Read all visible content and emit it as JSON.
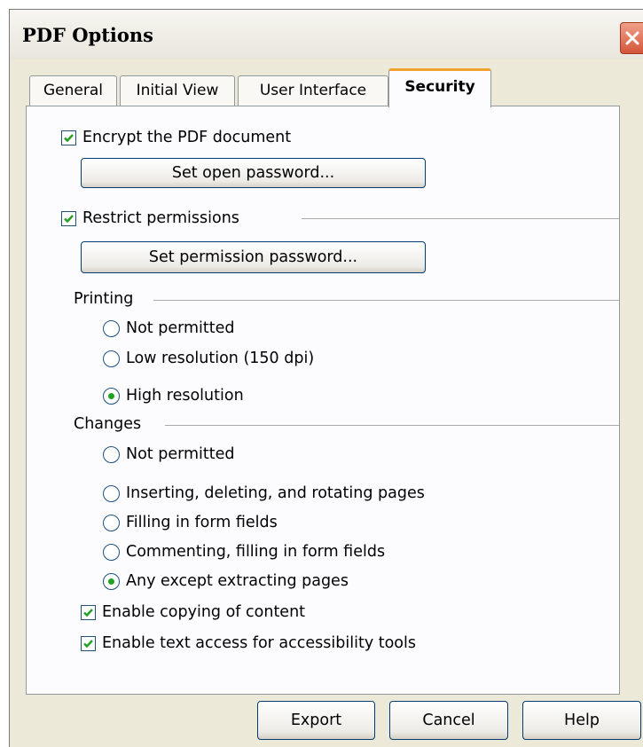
{
  "window": {
    "title": "PDF Options"
  },
  "tabs": [
    {
      "label": "General"
    },
    {
      "label": "Initial View"
    },
    {
      "label": "User Interface"
    },
    {
      "label": "Security",
      "active": true
    }
  ],
  "security": {
    "encrypt": {
      "label": "Encrypt the PDF document",
      "checked": true
    },
    "open_password_button": "Set open password...",
    "restrict": {
      "label": "Restrict permissions",
      "checked": true
    },
    "permission_password_button": "Set permission password...",
    "printing": {
      "label": "Printing",
      "options": [
        {
          "label": "Not permitted",
          "selected": false
        },
        {
          "label": "Low resolution (150 dpi)",
          "selected": false
        },
        {
          "label": "High resolution",
          "selected": true
        }
      ]
    },
    "changes": {
      "label": "Changes",
      "options": [
        {
          "label": "Not permitted",
          "selected": false
        },
        {
          "label": "Inserting, deleting, and rotating pages",
          "selected": false
        },
        {
          "label": "Filling in form fields",
          "selected": false
        },
        {
          "label": "Commenting, filling in form fields",
          "selected": false
        },
        {
          "label": "Any except extracting pages",
          "selected": true
        }
      ]
    },
    "copy_content": {
      "label": "Enable copying of content",
      "checked": true
    },
    "text_access": {
      "label": "Enable text access for accessibility tools",
      "checked": true
    }
  },
  "footer": {
    "export_label": "Export",
    "cancel_label": "Cancel",
    "help_label": "Help"
  },
  "colors": {
    "accent": "#21A121",
    "active_tab": "#F1A12F",
    "close": "#D4553A"
  }
}
